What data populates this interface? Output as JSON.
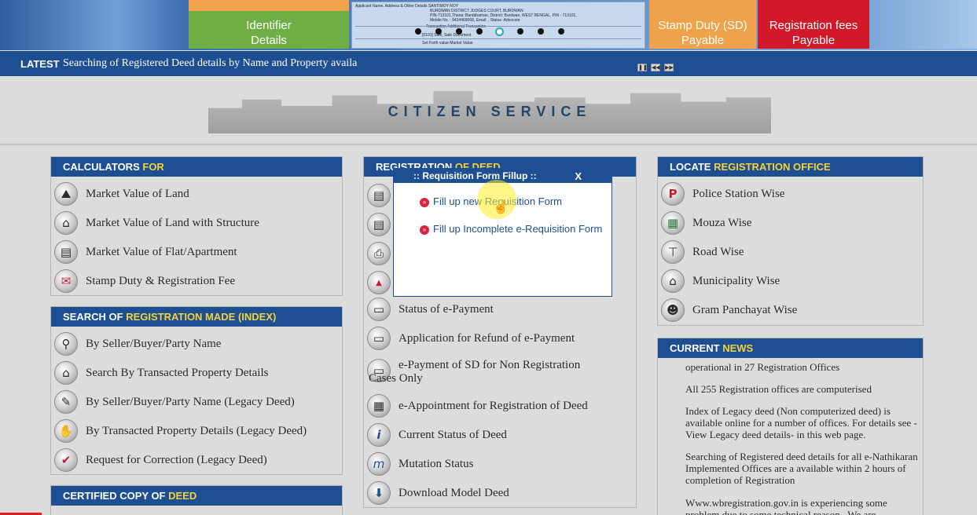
{
  "banner": {
    "identifier_label": "Identifier Details",
    "stamp_label": "Stamp Duty (SD) Payable",
    "reg_fee_label": "Registration fees Payable",
    "doc_lines": [
      "Applicant Name, Address & Other Details    SANTIMOY ROY",
      "BURDWAN DISTRICT JUDGES COURT, BURDWAN",
      "PIN-713101,Thana: Barddhaman, District: Burdwan, WEST BENGAL, PIN - 713101,",
      "Mobile No. : 9434469068, Email: , Status :Advocate",
      "Transaction    Additional Transaction",
      "[0101] Sale, Sale Document",
      "Set Forth value    Market Value"
    ]
  },
  "latest": {
    "label": "LATEST",
    "ticker": "Searching of Registered Deed details by Name and Property availa",
    "controls": [
      "pause",
      "prev",
      "next"
    ]
  },
  "citizen_title": "CITIZEN SERVICE",
  "calculators": {
    "heading_a": "CALCULATORS",
    "heading_b": "FOR",
    "items": [
      {
        "label": "Market Value of Land",
        "icon": "land-calc-icon",
        "glyph": "⛰"
      },
      {
        "label": "Market Value of Land with Structure",
        "icon": "structure-calc-icon",
        "glyph": "⌂"
      },
      {
        "label": "Market Value of Flat/Apartment",
        "icon": "flat-calc-icon",
        "glyph": "▤"
      },
      {
        "label": "Stamp Duty & Registration Fee",
        "icon": "stamp-duty-icon",
        "glyph": "✉"
      }
    ]
  },
  "search": {
    "heading_a": "SEARCH OF",
    "heading_b": "REGISTRATION MADE (INDEX)",
    "items": [
      {
        "label": "By Seller/Buyer/Party Name",
        "icon": "person-search-icon",
        "glyph": "⚲"
      },
      {
        "label": "Search By Transacted Property Details",
        "icon": "property-search-icon",
        "glyph": "⌂"
      },
      {
        "label": "By Seller/Buyer/Party Name (Legacy Deed)",
        "icon": "legacy-party-icon",
        "glyph": "✎"
      },
      {
        "label": "By Transacted Property Details (Legacy Deed)",
        "icon": "handshake-icon",
        "glyph": "✋"
      },
      {
        "label": "Request for Correction (Legacy Deed)",
        "icon": "correction-icon",
        "glyph": "✔"
      }
    ]
  },
  "certified": {
    "heading_a": "CERTIFIED COPY OF",
    "heading_b": "DEED"
  },
  "registration": {
    "heading_a": "REGISTRATION",
    "heading_b": "OF DEED",
    "hidden_icons": [
      "requisition-form-icon",
      "document-icon",
      "printer-icon",
      "duty-icon"
    ],
    "items": [
      {
        "label": "Status of e-Payment",
        "icon": "payment-status-icon",
        "glyph": "▭"
      },
      {
        "label": "Application for Refund of e-Payment",
        "icon": "refund-icon",
        "glyph": "▭"
      },
      {
        "label": "e-Payment of SD for Non Registration Cases Only",
        "icon": "epayment-sd-icon",
        "glyph": "▭"
      },
      {
        "label": "e-Appointment for Registration of Deed",
        "icon": "appointment-icon",
        "glyph": "▦"
      },
      {
        "label": "Current Status of Deed",
        "icon": "info-icon",
        "glyph": "i"
      },
      {
        "label": "Mutation Status",
        "icon": "mutation-icon",
        "glyph": "m"
      },
      {
        "label": "Download Model Deed",
        "icon": "download-icon",
        "glyph": "⬇"
      }
    ]
  },
  "popup": {
    "title": ":: Requisition Form Fillup ::",
    "close": "X",
    "links": [
      "Fill up new Requisition Form",
      "Fill up Incomplete e-Requisition Form"
    ]
  },
  "locate": {
    "heading_a": "LOCATE",
    "heading_b": "REGISTRATION OFFICE",
    "items": [
      {
        "label": "Police Station Wise",
        "icon": "police-icon",
        "glyph": "P"
      },
      {
        "label": "Mouza Wise",
        "icon": "map-icon",
        "glyph": "▦"
      },
      {
        "label": "Road Wise",
        "icon": "signpost-icon",
        "glyph": "⊤"
      },
      {
        "label": "Municipality Wise",
        "icon": "building-icon",
        "glyph": "⌂"
      },
      {
        "label": "Gram Panchayat Wise",
        "icon": "people-icon",
        "glyph": "☻"
      }
    ]
  },
  "news": {
    "heading_a": "CURRENT",
    "heading_b": "NEWS",
    "items": [
      "operational in 27 Registration Offices",
      "All 255 Registration offices are computerised",
      "Index of Legacy deed (Non computerized deed) is available online for a number of offices. For details see -View Legacy deed details- in this web page.",
      "Searching of Registered deed details for all e-Nathikaran Implemented Offices are a available within 2 hours of completion of Registration",
      "Www.wbregistration.gov.in is experiencing some problem due to some technical reason . We are"
    ]
  }
}
